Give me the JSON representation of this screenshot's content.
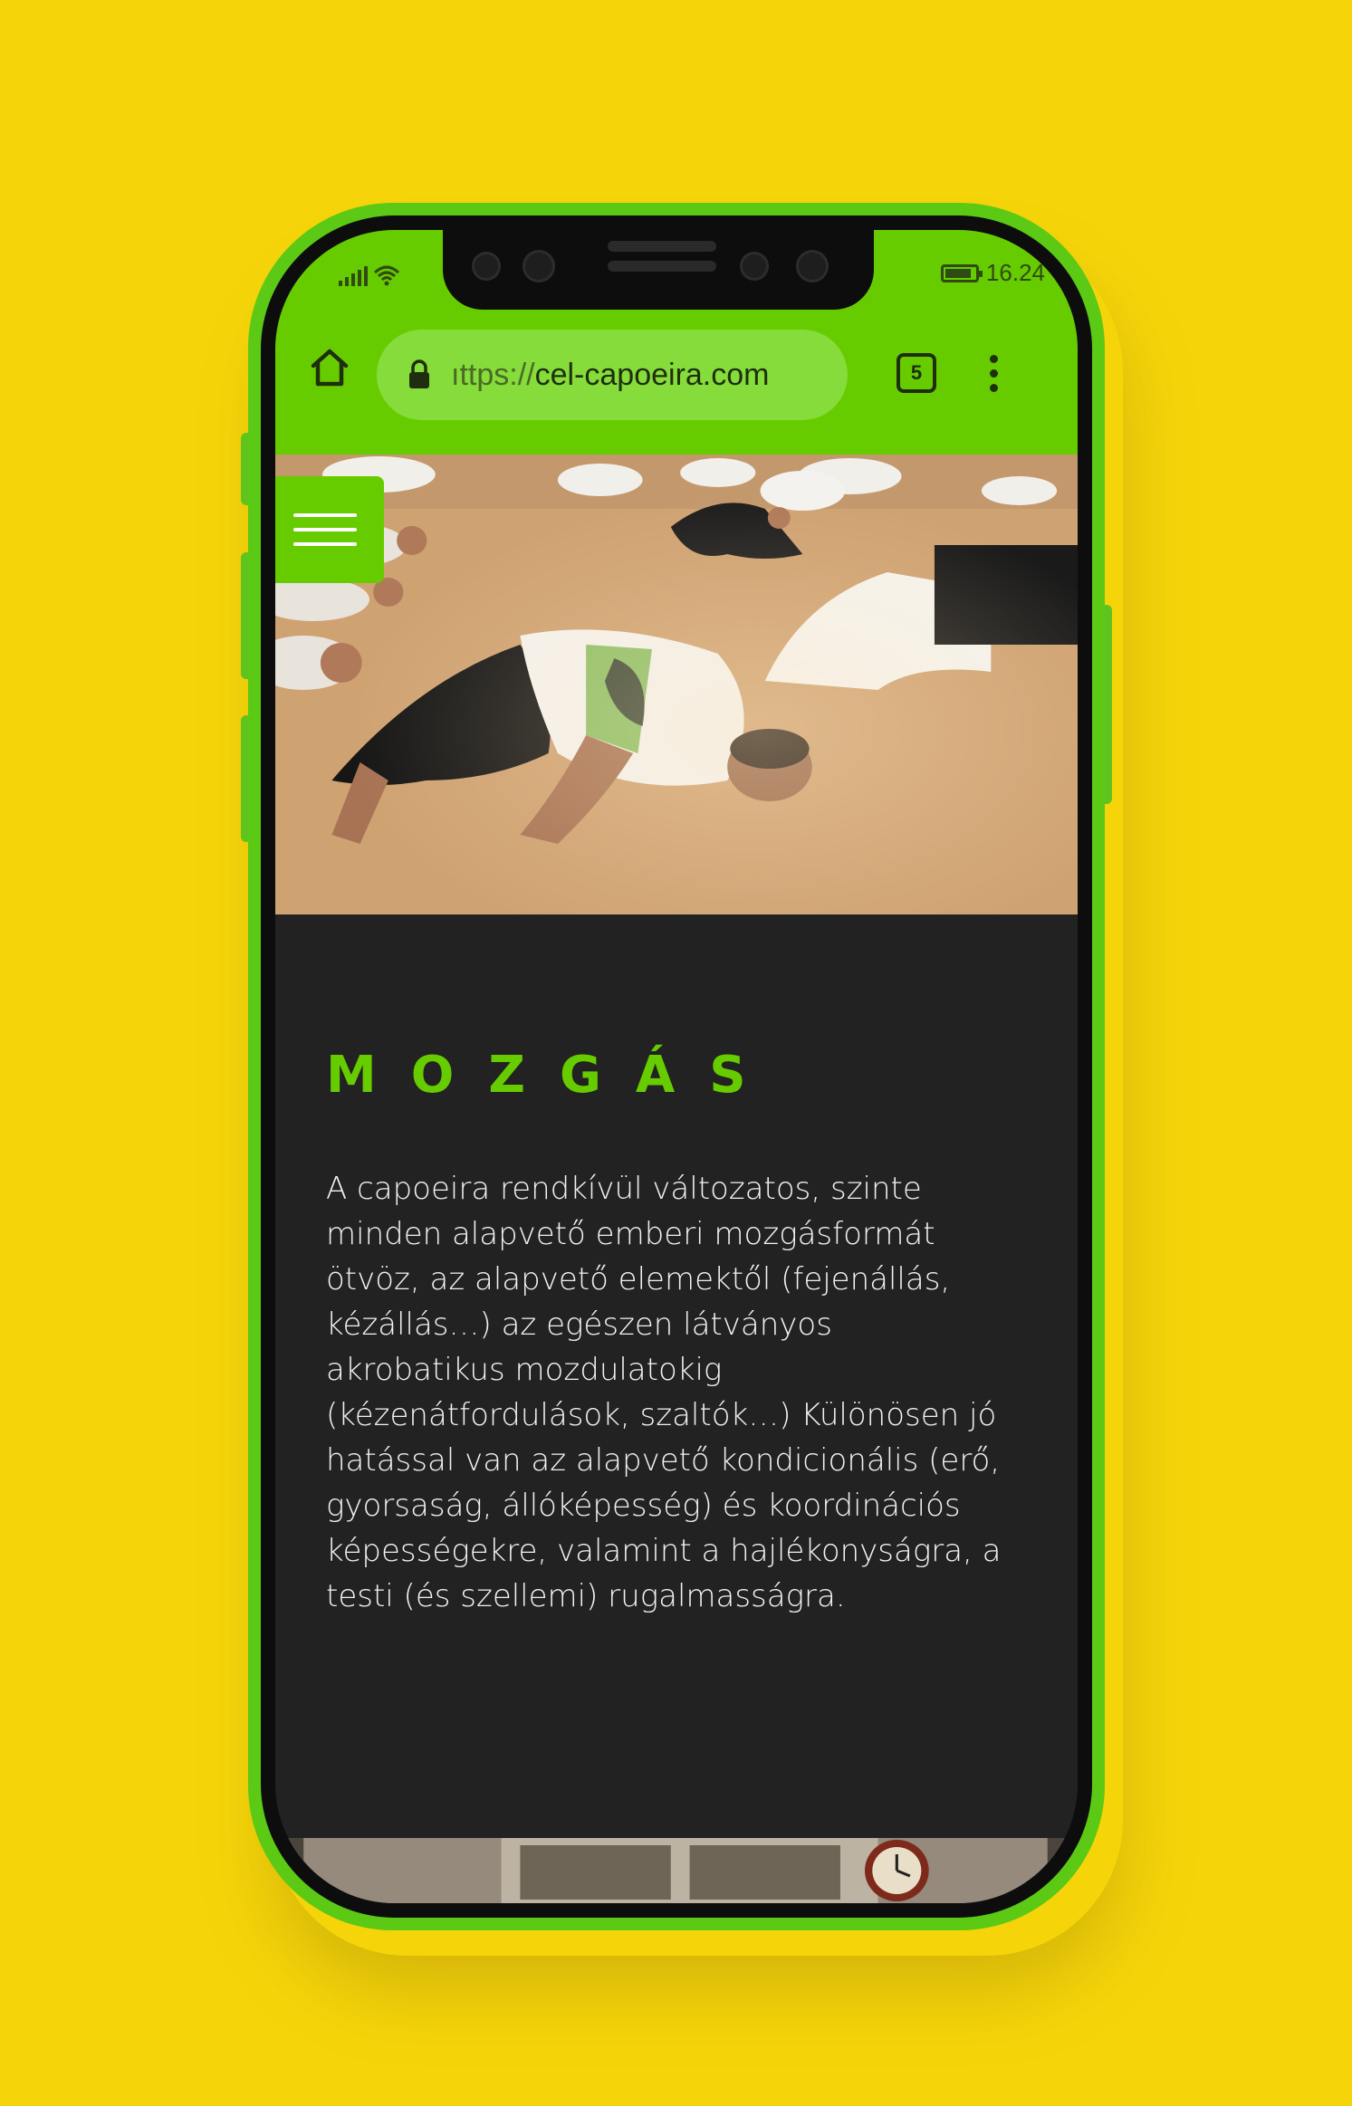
{
  "status_bar": {
    "time": "16.24",
    "battery_level": 0.9
  },
  "browser": {
    "url_protocol": "ıttps://",
    "url_host": "cel-capoeira.com",
    "tab_count": "5"
  },
  "hero": {
    "image_alt": "capoeira-training-photo"
  },
  "section": {
    "title": "MOZGÁS",
    "body": "A capoeira rendkívül változatos, szinte minden alapvető emberi mozgásformát ötvöz, az alapvető elemektől (fejenállás, kézállás…) az egészen látványos akrobatikus mozdulatokig (kézenátfordulások, szaltók…) Különösen jó hatással van az alapvető kondicionális (erő, gyorsaság, állóképesség) és koordinációs képességekre, valamint a hajlékonyságra, a testi (és szellemi) rugalmasságra."
  },
  "colors": {
    "background": "#f5d50a",
    "accent": "#66cc00",
    "dark": "#222222"
  }
}
